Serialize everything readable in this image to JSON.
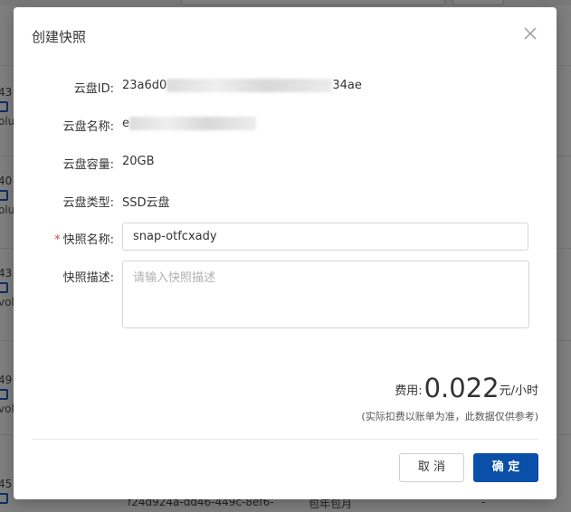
{
  "background": {
    "rows": [
      {
        "id": "43",
        "name": "olu"
      },
      {
        "id": "40",
        "name": "olu"
      },
      {
        "id": "43",
        "name": "vol"
      },
      {
        "id": "49",
        "name": "vol"
      },
      {
        "id": "45",
        "name": ""
      }
    ],
    "bottom_row": {
      "volume_id": "f24d924a-dd46-449c-8ef6-",
      "billing": "包年包月",
      "dash": "-"
    }
  },
  "dialog": {
    "title": "创建快照",
    "fields": {
      "disk_id": {
        "label": "云盘ID:",
        "value_prefix": "23a6d0",
        "value_suffix": "34ae"
      },
      "disk_name": {
        "label": "云盘名称:",
        "value_prefix": "e"
      },
      "disk_capacity": {
        "label": "云盘容量:",
        "value": "20GB"
      },
      "disk_type": {
        "label": "云盘类型:",
        "value": "SSD云盘"
      },
      "snapshot_name": {
        "label": "快照名称:",
        "required_mark": "*",
        "value": "snap-otfcxady"
      },
      "snapshot_desc": {
        "label": "快照描述:",
        "placeholder": "请输入快照描述"
      }
    },
    "fee": {
      "label": "费用:",
      "value": "0.022",
      "unit": "元/小时",
      "note": "(实际扣费以账单为准，此数据仅供参考)"
    },
    "buttons": {
      "cancel": "取 消",
      "ok": "确 定"
    }
  }
}
